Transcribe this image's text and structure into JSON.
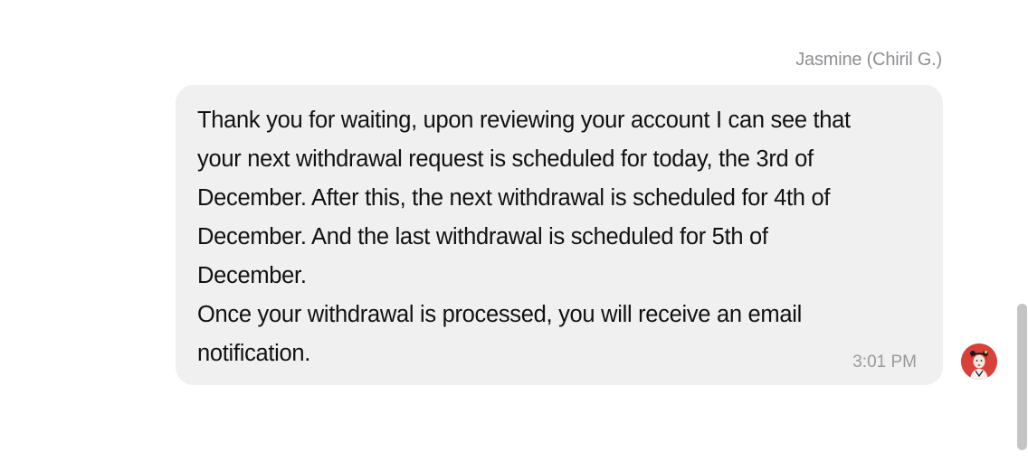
{
  "message": {
    "sender_name": "Jasmine (Chiril G.)",
    "lines": [
      "Thank you for waiting, upon reviewing your account I can see that",
      "your next withdrawal request is scheduled for today, the 3rd of",
      "December. After this, the next withdrawal is scheduled for 4th of",
      "December. And the last withdrawal is scheduled for 5th of",
      "December.",
      "Once your withdrawal is processed, you will receive an email",
      "notification."
    ],
    "time": "3:01 PM",
    "avatar_icon": "agent-avatar-icon",
    "bubble_color": "#f0f0f0",
    "avatar_color": "#d9403a"
  }
}
